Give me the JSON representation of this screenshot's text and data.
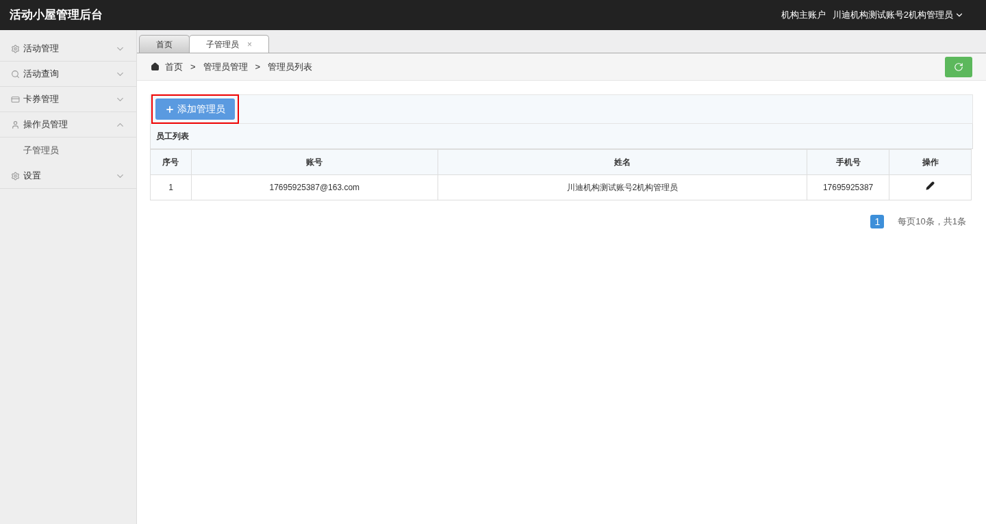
{
  "header": {
    "title": "活动小屋管理后台",
    "account_type": "机构主账户",
    "user": "川迪机构测试账号2机构管理员"
  },
  "sidebar": {
    "items": [
      {
        "label": "活动管理",
        "expanded": false
      },
      {
        "label": "活动查询",
        "expanded": false
      },
      {
        "label": "卡券管理",
        "expanded": false
      },
      {
        "label": "操作员管理",
        "expanded": true,
        "children": [
          {
            "label": "子管理员"
          }
        ]
      },
      {
        "label": "设置",
        "expanded": false
      }
    ]
  },
  "tabs": [
    {
      "label": "首页",
      "selected": false
    },
    {
      "label": "子管理员",
      "selected": true,
      "close": "×"
    }
  ],
  "breadcrumb": [
    "首页",
    "管理员管理",
    "管理员列表"
  ],
  "breadcrumb_separator": ">",
  "add_button": "添加管理员",
  "table": {
    "title": "员工列表",
    "columns": [
      "序号",
      "账号",
      "姓名",
      "手机号",
      "操作"
    ],
    "rows": [
      [
        "1",
        "17695925387@163.com",
        "川迪机构测试账号2机构管理员",
        "17695925387"
      ]
    ]
  },
  "pagination": {
    "pages": [
      {
        "label": "1",
        "selected": true
      }
    ],
    "summary": "每页10条，共1条"
  }
}
